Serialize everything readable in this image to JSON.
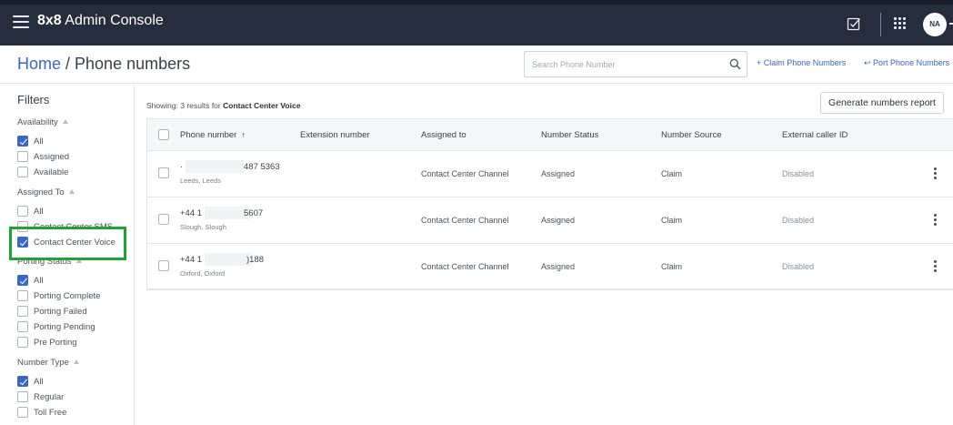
{
  "header": {
    "brand_bold": "8x8",
    "brand_rest": " Admin Console",
    "avatar_initials": "NA"
  },
  "titlebar": {
    "home": "Home",
    "separator": " / ",
    "page": "Phone numbers",
    "search_placeholder": "Search Phone Number",
    "claim_label": "+  Claim Phone Numbers",
    "port_label": "↩ Port Phone Numbers"
  },
  "filters": {
    "title": "Filters",
    "availability": {
      "heading": "Availability",
      "options": [
        {
          "label": "All",
          "checked": true
        },
        {
          "label": "Assigned",
          "checked": false
        },
        {
          "label": "Available",
          "checked": false
        }
      ]
    },
    "assigned_to": {
      "heading": "Assigned To",
      "options": [
        {
          "label": "All",
          "checked": false
        },
        {
          "label": "Contact Center SMS",
          "checked": false
        },
        {
          "label": "Contact Center Voice",
          "checked": true
        }
      ]
    },
    "porting_status": {
      "heading": "Porting Status",
      "options": [
        {
          "label": "All",
          "checked": true
        },
        {
          "label": "Porting Complete",
          "checked": false
        },
        {
          "label": "Porting Failed",
          "checked": false
        },
        {
          "label": "Porting Pending",
          "checked": false
        },
        {
          "label": "Pre Porting",
          "checked": false
        }
      ]
    },
    "number_type": {
      "heading": "Number Type",
      "options": [
        {
          "label": "All",
          "checked": true
        },
        {
          "label": "Regular",
          "checked": false
        },
        {
          "label": "Toll Free",
          "checked": false
        }
      ]
    }
  },
  "results": {
    "showing_prefix": "Showing: 3 results for ",
    "showing_filter": "Contact Center Voice",
    "report_button": "Generate numbers report"
  },
  "table": {
    "columns": [
      "Phone number",
      "Extension number",
      "Assigned to",
      "Number Status",
      "Number Source",
      "External caller ID"
    ],
    "sort_indicator": "↑",
    "rows": [
      {
        "phone_a": "·",
        "phone_b": "487 5363",
        "location": "Leeds, Leeds",
        "extension": "",
        "assigned_to": "Contact Center Channel",
        "status": "Assigned",
        "source": "Claim",
        "caller_id": "Disabled"
      },
      {
        "phone_a": "+44 1",
        "phone_b": "5607",
        "location": "Slough, Slough",
        "extension": "",
        "assigned_to": "Contact Center Channel",
        "status": "Assigned",
        "source": "Claim",
        "caller_id": "Disabled"
      },
      {
        "phone_a": "+44 1",
        "phone_b": ")188",
        "location": "Oxford, Oxford",
        "extension": "",
        "assigned_to": "Contact Center Channel",
        "status": "Assigned",
        "source": "Claim",
        "caller_id": "Disabled"
      }
    ]
  },
  "colors": {
    "header_bg": "#262d3d",
    "accent": "#3a66c4",
    "highlight": "#22a134"
  }
}
